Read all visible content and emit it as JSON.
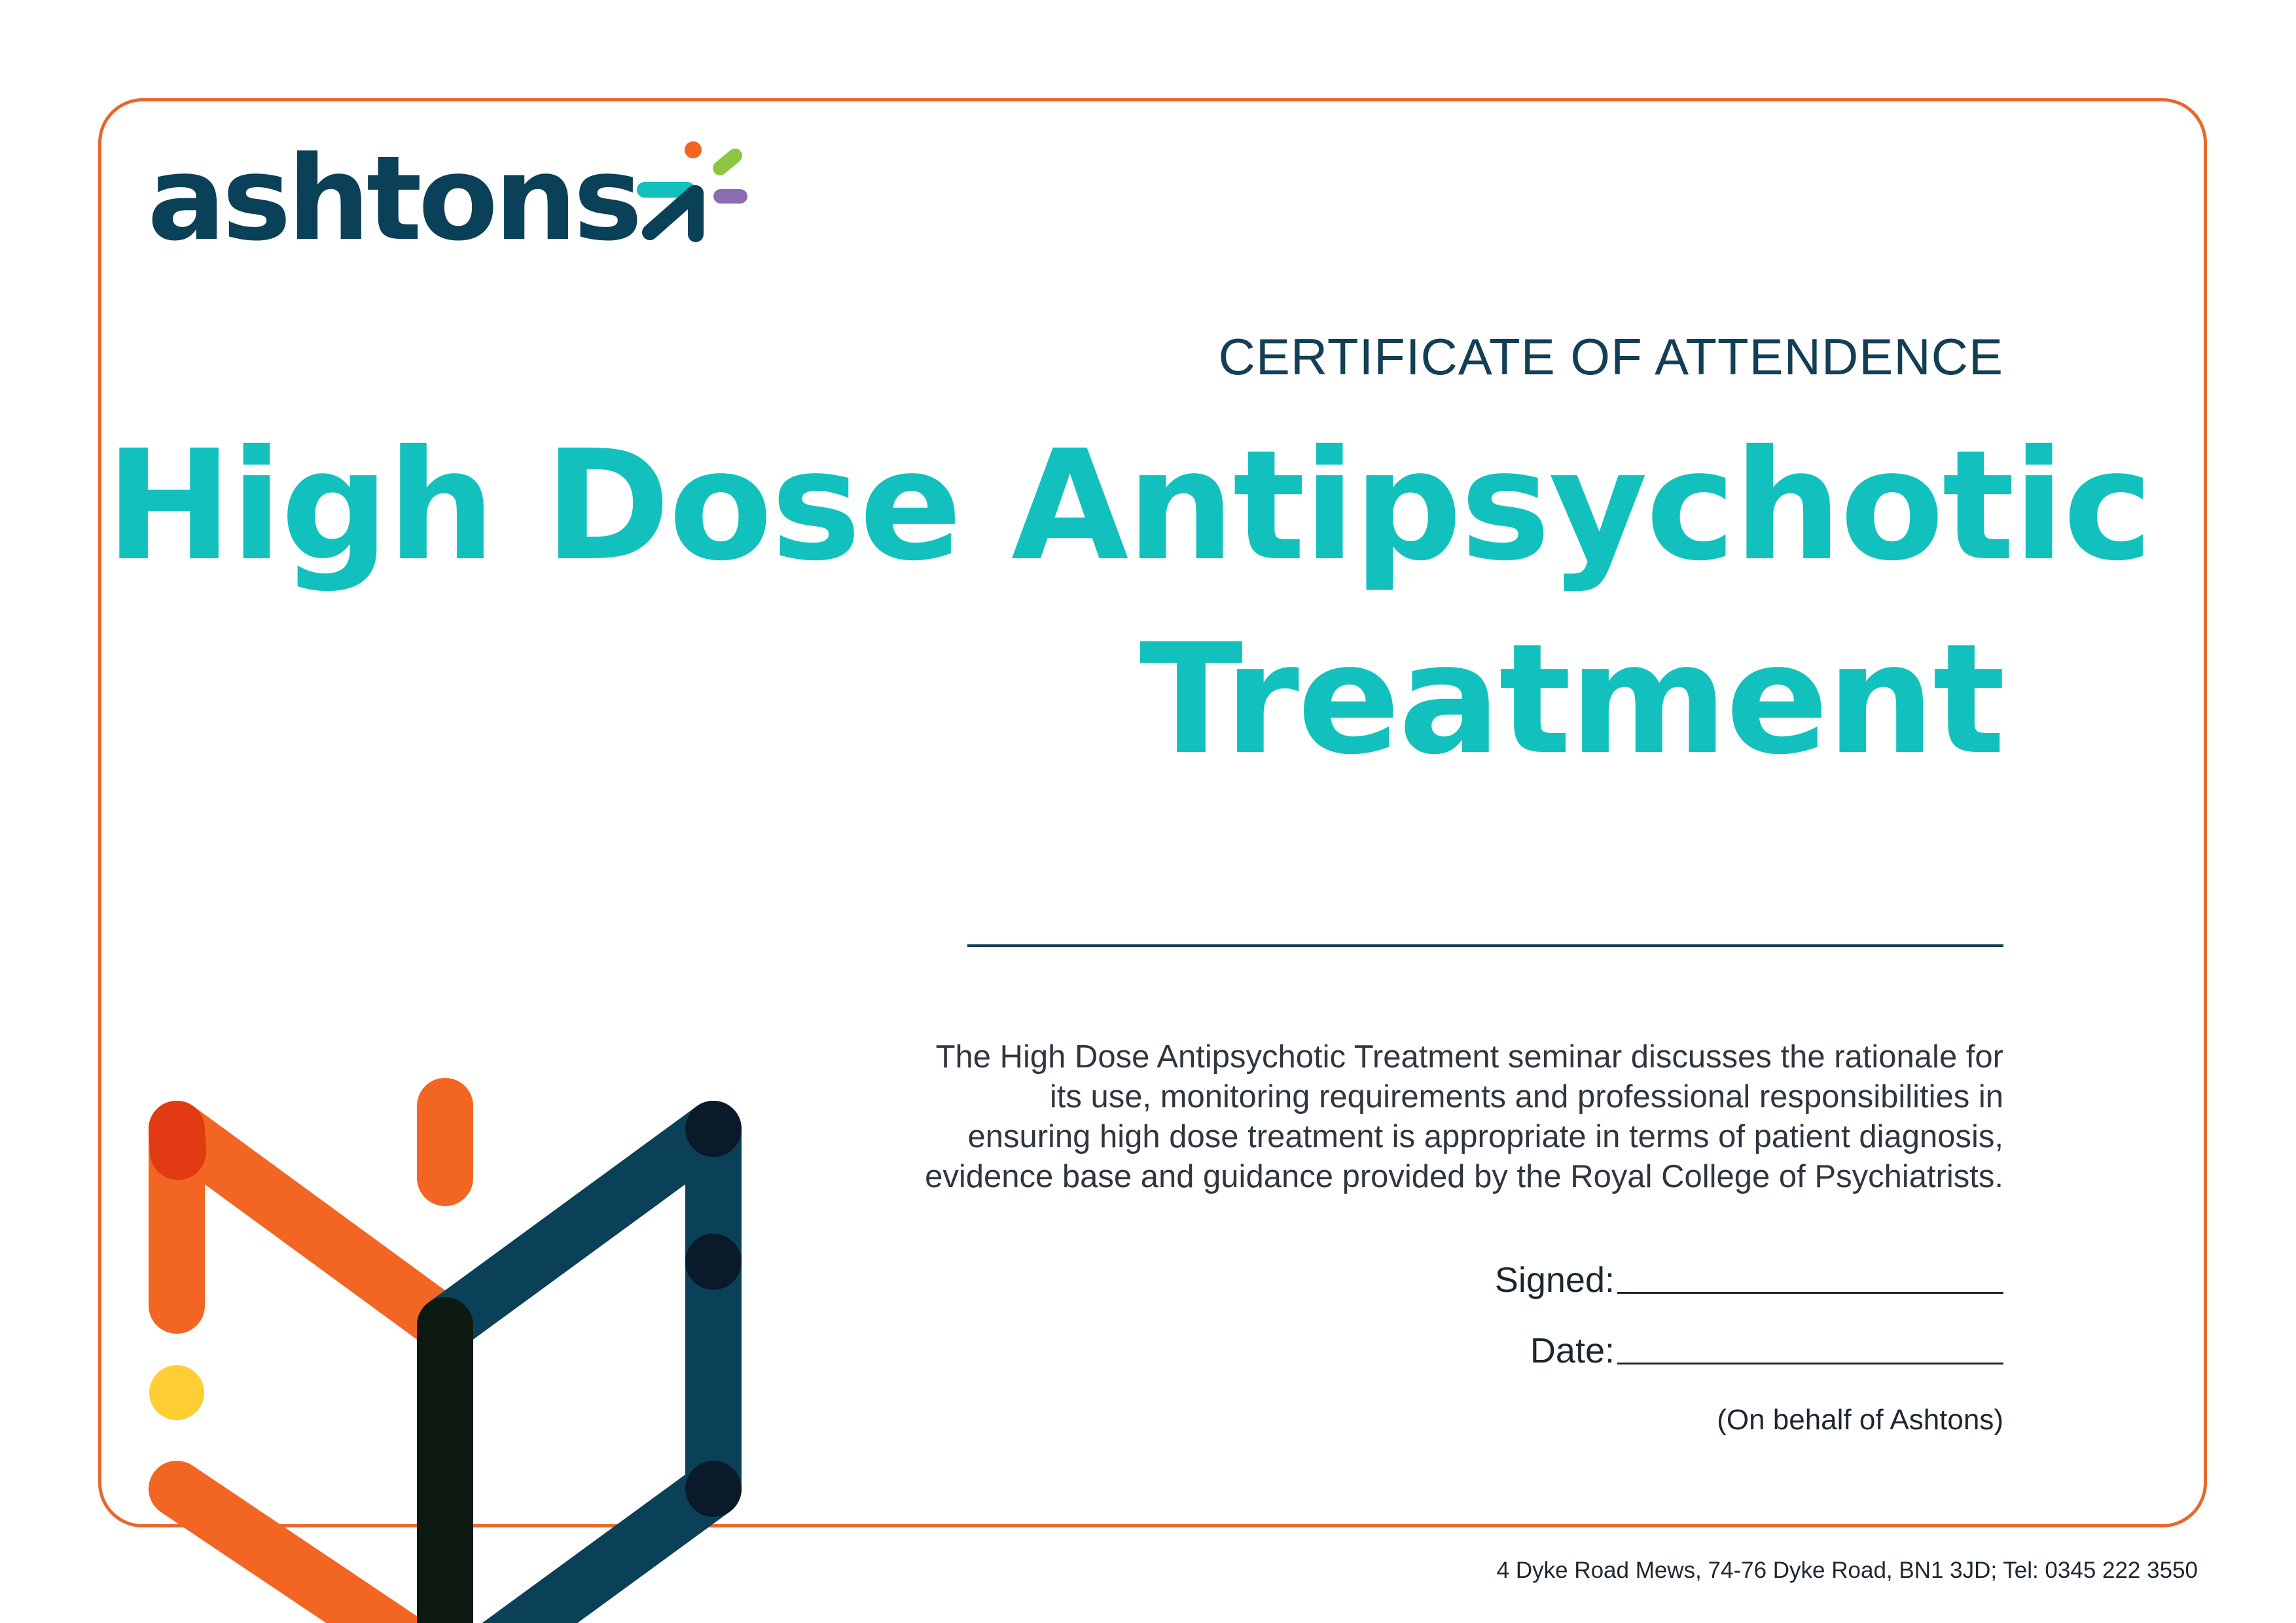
{
  "brand": {
    "name": "ashtons",
    "colors": {
      "navy": "#0b4158",
      "teal": "#12c1bd",
      "orange": "#f26522",
      "lime": "#8dc63f",
      "purple": "#8c6bb1",
      "yellow": "#ffcd34"
    },
    "logo_icon": "arrow-sparkle-icon"
  },
  "certificate": {
    "type": "CERTIFICATE OF ATTENDENCE",
    "title_line1": "High Dose Antipsychotic",
    "title_line2": "Treatment",
    "description": "The High Dose Antipsychotic Treatment seminar discusses the rationale for its use, monitoring requirements and professional responsibilities in ensuring high dose treatment is appropriate in terms of patient diagnosis, evidence base and guidance provided by the Royal College of Psychiatrists.",
    "signed_label": "Signed:",
    "date_label": "Date:",
    "on_behalf": "(On behalf of Ashtons)"
  },
  "footer": {
    "address": "4 Dyke Road Mews, 74-76 Dyke Road, BN1 3JD; Tel: 0345 222 3550"
  },
  "decoration": {
    "icon": "abstract-book-shape-icon"
  }
}
